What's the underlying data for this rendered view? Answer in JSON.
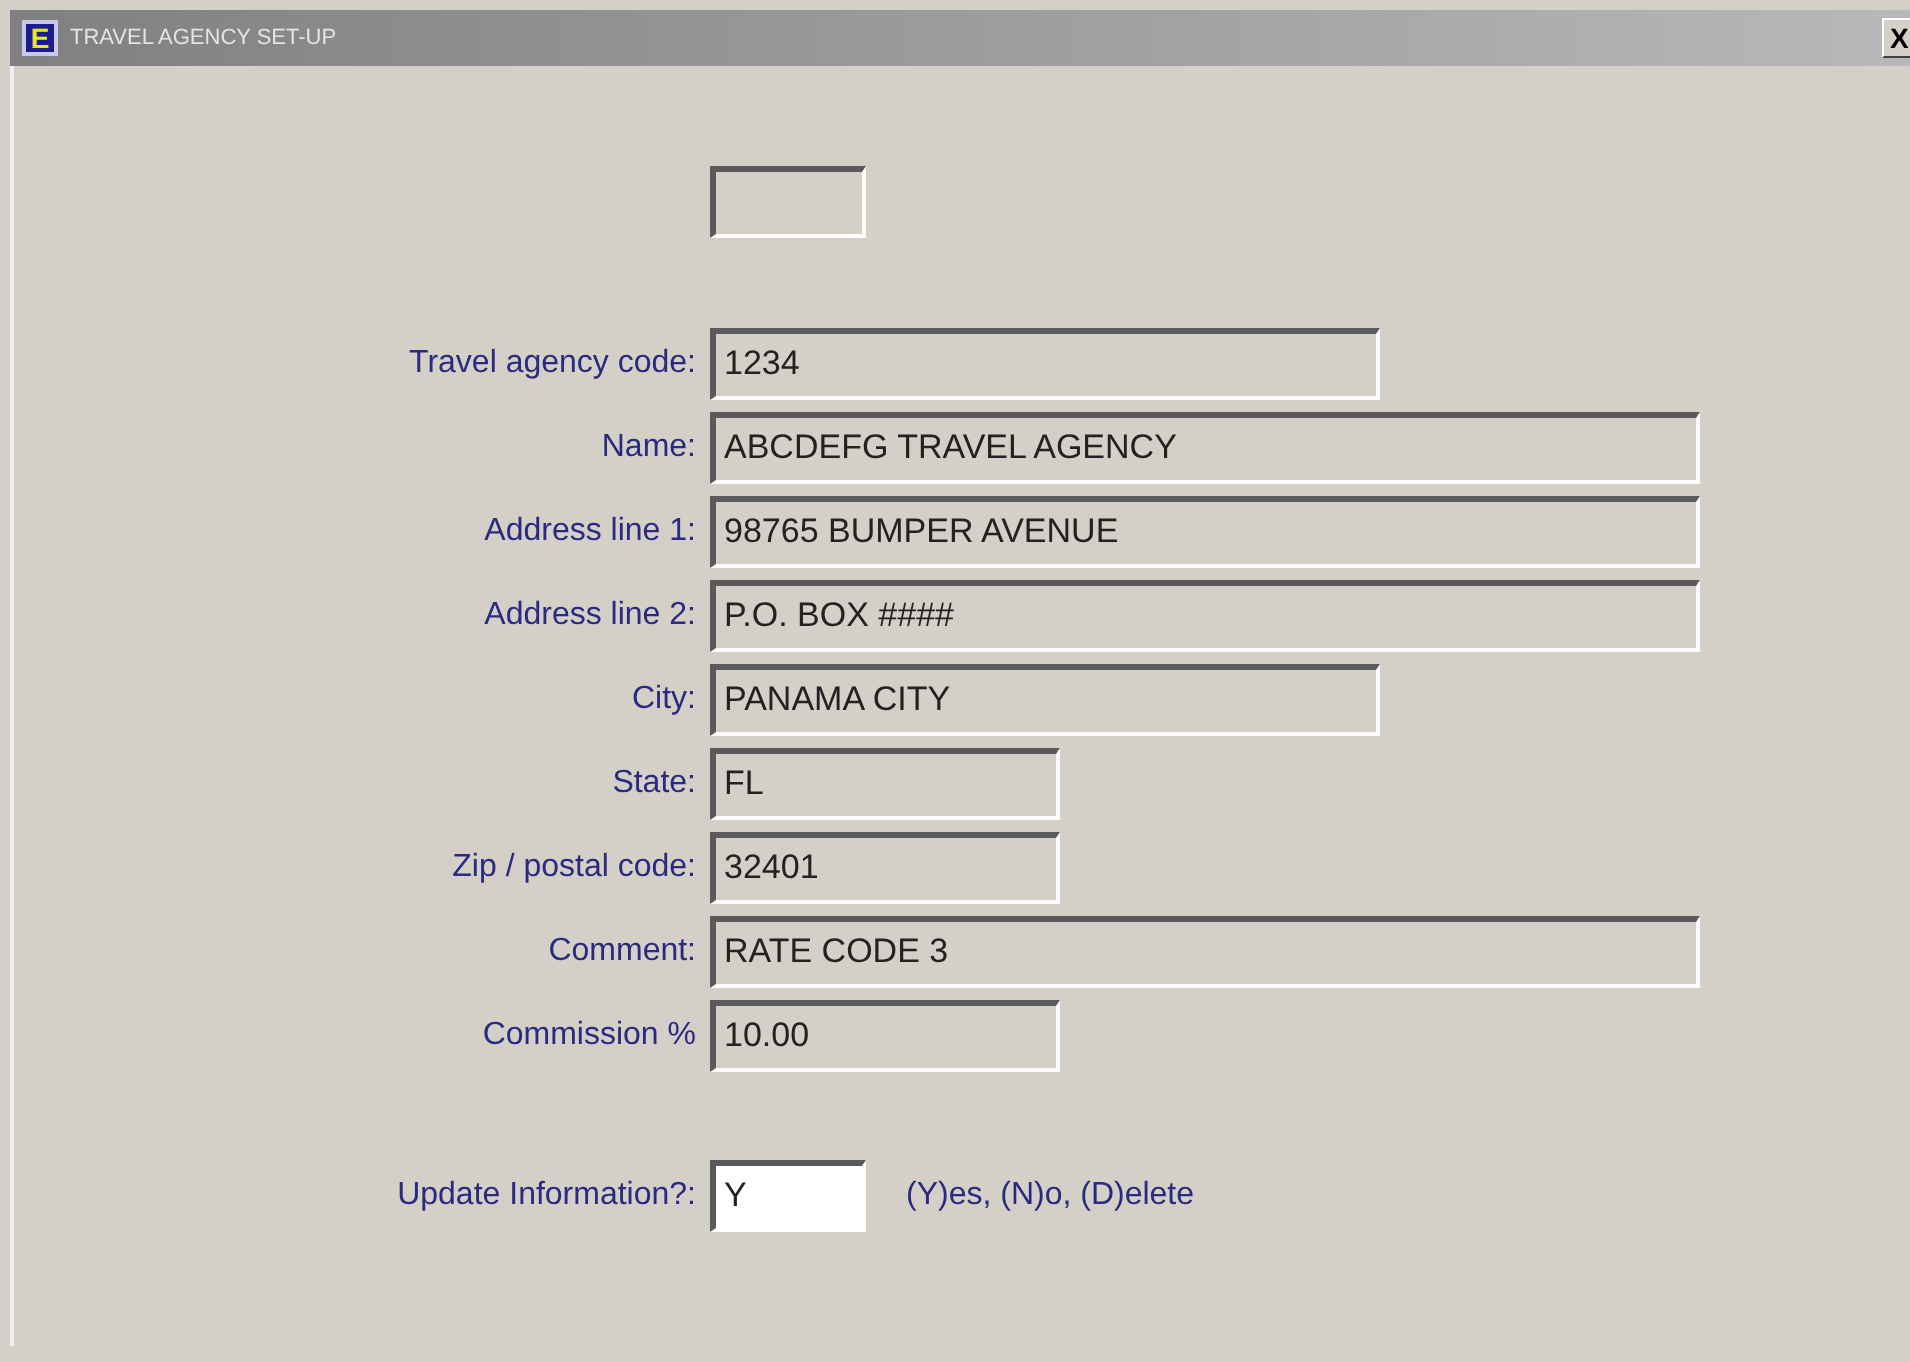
{
  "window": {
    "title": "TRAVEL AGENCY SET-UP",
    "icon_letter": "E",
    "close": "X"
  },
  "fields": [
    {
      "label": "Travel agency code:",
      "value": "1234",
      "kind": "medium"
    },
    {
      "label": "Name:",
      "value": "ABCDEFG TRAVEL AGENCY",
      "kind": "long"
    },
    {
      "label": "Address line 1:",
      "value": "98765 BUMPER AVENUE",
      "kind": "long"
    },
    {
      "label": "Address line 2:",
      "value": "P.O. BOX ####",
      "kind": "long"
    },
    {
      "label": "City:",
      "value": "PANAMA CITY",
      "kind": "medium"
    },
    {
      "label": "State:",
      "value": "FL",
      "kind": "short"
    },
    {
      "label": "Zip / postal code:",
      "value": "32401",
      "kind": "short"
    },
    {
      "label": "Comment:",
      "value": "RATE CODE 3",
      "kind": "long"
    },
    {
      "label": "Commission %",
      "value": "10.00",
      "kind": "short"
    }
  ],
  "update": {
    "label": "Update Information?:",
    "value": "Y",
    "hint": "(Y)es, (N)o, (D)elete",
    "focused": true
  }
}
